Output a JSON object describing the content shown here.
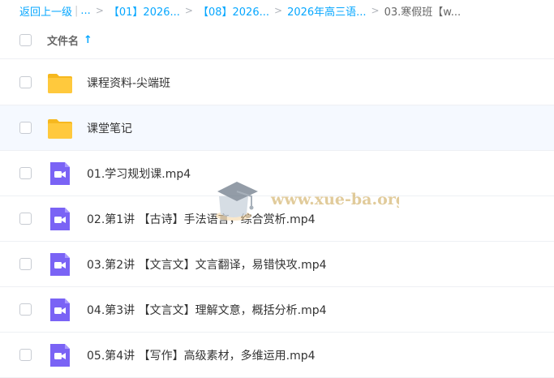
{
  "breadcrumb": {
    "back": "返回上一级",
    "pipe": "|",
    "ellipsis": "...",
    "crumbs": [
      "【01】2026...",
      "【08】2026...",
      "2026年高三语..."
    ],
    "current": "03.寒假班【w...",
    "separator": ">"
  },
  "header": {
    "column_label": "文件名",
    "sort_arrow": "↑"
  },
  "files": [
    {
      "name": "课程资料-尖端班",
      "type": "folder"
    },
    {
      "name": "课堂笔记",
      "type": "folder"
    },
    {
      "name": "01.学习规划课.mp4",
      "type": "video"
    },
    {
      "name": "02.第1讲 【古诗】手法语言，综合赏析.mp4",
      "type": "video"
    },
    {
      "name": "03.第2讲 【文言文】文言翻译，易错快攻.mp4",
      "type": "video"
    },
    {
      "name": "04.第3讲 【文言文】理解文意，概括分析.mp4",
      "type": "video"
    },
    {
      "name": "05.第4讲 【写作】高级素材，多维运用.mp4",
      "type": "video"
    }
  ],
  "watermark": {
    "text": "www.xue-ba.org"
  },
  "colors": {
    "link": "#06a7ff",
    "folder": "#ffc93d",
    "video": "#7a63f5",
    "row_hover": "#f5f9ff"
  },
  "icons": {
    "folder": "folder-icon",
    "video": "video-file-icon",
    "sort": "arrow-up-icon",
    "watermark": "graduation-cap-icon"
  }
}
